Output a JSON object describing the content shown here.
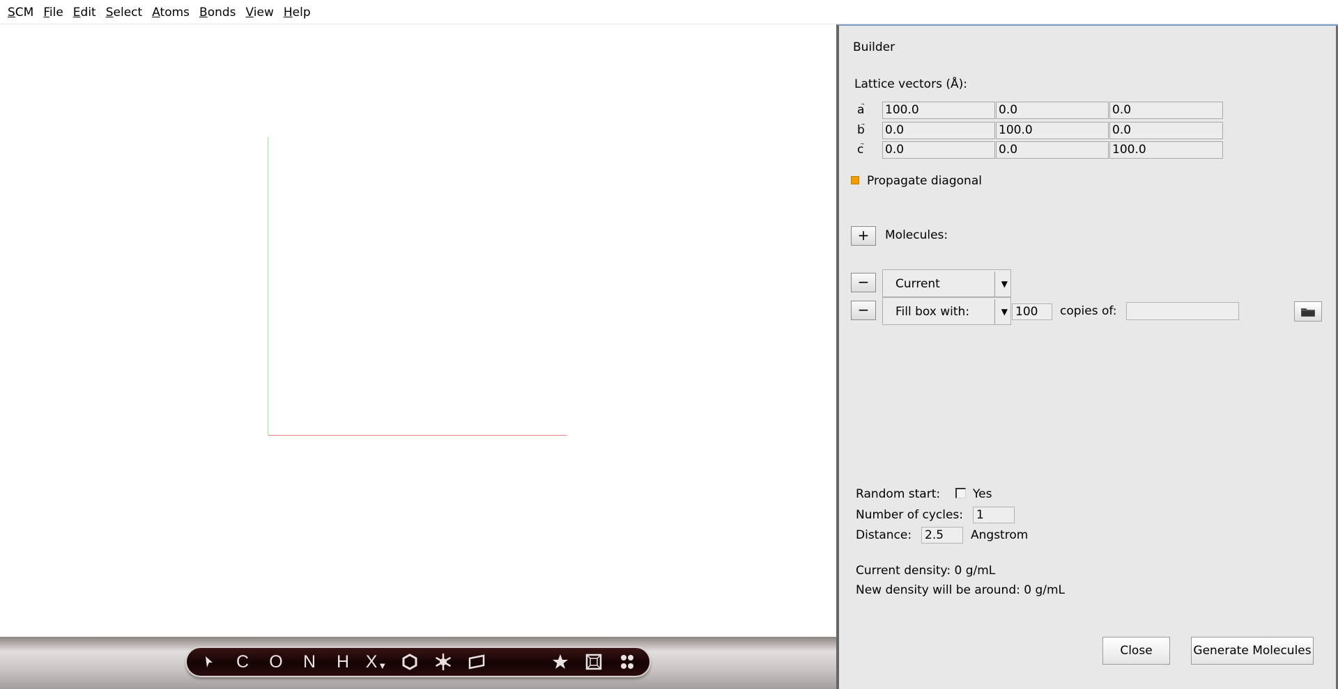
{
  "menu": [
    {
      "acc": "S",
      "rest": "CM"
    },
    {
      "acc": "F",
      "rest": "ile"
    },
    {
      "acc": "E",
      "rest": "dit"
    },
    {
      "acc": "S",
      "rest": "elect"
    },
    {
      "acc": "A",
      "rest": "toms"
    },
    {
      "acc": "B",
      "rest": "onds"
    },
    {
      "acc": "V",
      "rest": "iew"
    },
    {
      "acc": "H",
      "rest": "elp"
    }
  ],
  "toolbar": {
    "carbon": "C",
    "oxygen": "O",
    "nitrogen": "N",
    "hydrogen": "H",
    "other_element": "X",
    "icons": [
      "pointer-icon",
      "ring-icon",
      "snowflake-icon",
      "plane-icon",
      "star-icon",
      "cell-icon",
      "dots-icon"
    ]
  },
  "builder": {
    "title": "Builder",
    "lattice_label": "Lattice vectors (Å):",
    "vectors": [
      {
        "label": "a",
        "values": [
          "100.0",
          "0.0",
          "0.0"
        ]
      },
      {
        "label": "b",
        "values": [
          "0.0",
          "100.0",
          "0.0"
        ]
      },
      {
        "label": "c",
        "values": [
          "0.0",
          "0.0",
          "100.0"
        ]
      }
    ],
    "propagate_label": "Propagate diagonal",
    "propagate_color": "#f29c00",
    "add_button": "+",
    "molecules_label": "Molecules:",
    "remove_button": "−",
    "molecule_rows": [
      {
        "mode": "Current"
      },
      {
        "mode": "Fill box with:",
        "copies": "100",
        "copies_label": "copies of:",
        "source": ""
      }
    ],
    "random_start_label": "Random start:",
    "random_start_option": "Yes",
    "cycles_label": "Number of cycles:",
    "cycles_value": "1",
    "distance_label": "Distance:",
    "distance_value": "2.5",
    "distance_unit": "Angstrom",
    "current_density": "Current density: 0 g/mL",
    "new_density": "New density will be around: 0 g/mL",
    "close_button": "Close",
    "generate_button": "Generate Molecules"
  }
}
